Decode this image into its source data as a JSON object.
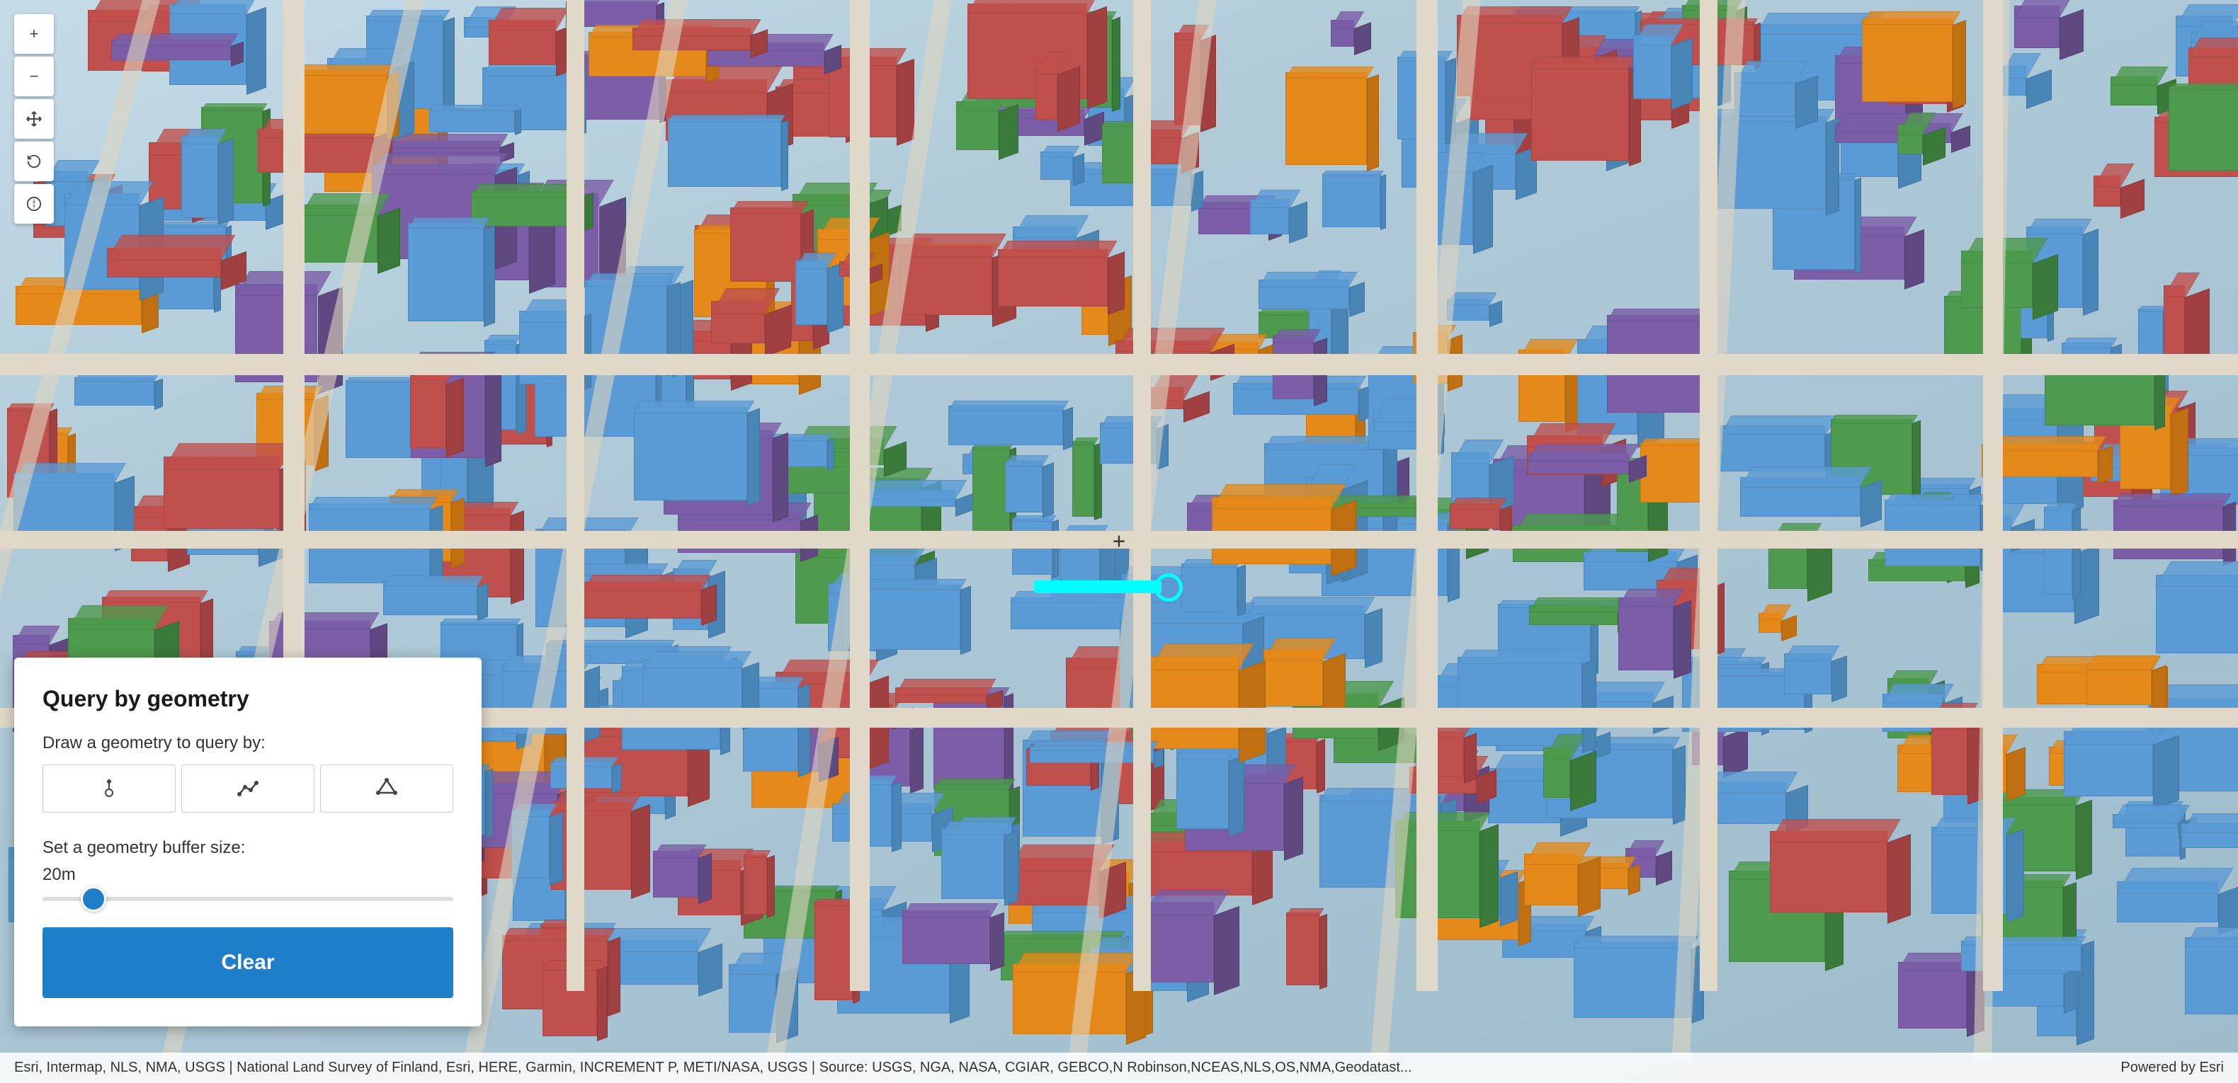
{
  "map": {
    "background_color": "#b8d4e8",
    "alt": "3D city map of Helsinki area"
  },
  "controls": {
    "zoom_in_label": "+",
    "zoom_out_label": "−",
    "pan_icon": "⊕",
    "reset_icon": "↺",
    "compass_icon": "◎"
  },
  "panel": {
    "title": "Query by geometry",
    "draw_label": "Draw a geometry to query by:",
    "point_tool_icon": "◎",
    "polyline_tool_icon": "〜",
    "polygon_tool_icon": "△",
    "buffer_label": "Set a geometry buffer size:",
    "buffer_value": "20m",
    "buffer_min": 0,
    "buffer_max": 200,
    "buffer_current": 20,
    "clear_button_label": "Clear"
  },
  "attribution": {
    "left": "Esri, Intermap, NLS, NMA, USGS | National Land Survey of Finland, Esri, HERE, Garmin, INCREMENT P, METI/NASA, USGS | Source: USGS, NGA, NASA, CGIAR, GEBCO,N Robinson,NCEAS,NLS,OS,NMA,Geodatast...",
    "right": "Powered by Esri"
  },
  "buildings": {
    "colors": {
      "blue": "#5b9bd5",
      "red": "#c0504d",
      "orange": "#e5891a",
      "green": "#4e9a4e",
      "purple": "#7b5ea7"
    }
  }
}
